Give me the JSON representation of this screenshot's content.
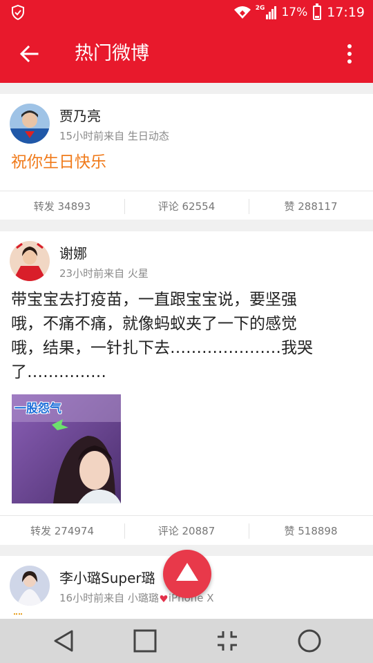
{
  "status_bar": {
    "network_label": "2G",
    "battery_percent": "17%",
    "battery_level": 0.17,
    "time": "17:19"
  },
  "app_bar": {
    "title": "热门微博",
    "back_icon": "arrow-left-icon",
    "menu_icon": "more-vertical-icon"
  },
  "posts": [
    {
      "author": "贾乃亮",
      "meta": "15小时前来自 生日动态",
      "text": "祝你生日快乐",
      "repost": "转发 34893",
      "comment": "评论 62554",
      "like": "赞 288117"
    },
    {
      "author": "谢娜",
      "meta": "23小时前来自 火星",
      "text_lines": [
        "带宝宝去打疫苗，一直跟宝宝说，要坚强",
        "哦，不痛不痛，就像蚂蚁夹了一下的感觉",
        "哦，结果，一针扎下去…………………我哭",
        "了……………"
      ],
      "image_caption": "一股怨气",
      "repost": "转发 274974",
      "comment": "评论 20887",
      "like": "赞 518898"
    },
    {
      "author": "李小璐Super璐",
      "meta_prefix": "16小时前来自 小璐璐",
      "meta_suffix": "iPhone X"
    }
  ],
  "fab": {
    "icon": "scroll-to-top-icon"
  },
  "nav_bar": {
    "icons": [
      "back-triangle-icon",
      "home-square-icon",
      "recents-compress-icon",
      "circle-icon"
    ]
  },
  "colors": {
    "brand_red": "#e8192c",
    "fab_red": "#e8394a",
    "orange_text": "#f07a1a"
  }
}
